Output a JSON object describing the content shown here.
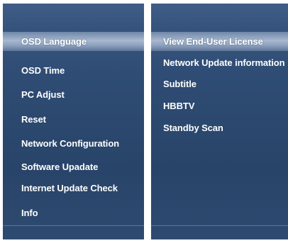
{
  "left_menu": {
    "items": [
      {
        "label": "OSD Language"
      },
      {
        "label": "OSD Time"
      },
      {
        "label": "PC Adjust"
      },
      {
        "label": "Reset"
      },
      {
        "label": "Network Configuration"
      },
      {
        "label": "Software Upadate"
      },
      {
        "label": "Internet Update Check"
      },
      {
        "label": "Info"
      }
    ],
    "selected_index": 0
  },
  "right_menu": {
    "items": [
      {
        "label": "View End-User License"
      },
      {
        "label": "Network Update information"
      },
      {
        "label": "Subtitle"
      },
      {
        "label": "HBBTV"
      },
      {
        "label": "Standby Scan"
      }
    ],
    "selected_index": 0
  },
  "colors": {
    "panel_bg": "#2f4c74",
    "highlight": "#a7b8cf",
    "text": "#ffffff"
  }
}
